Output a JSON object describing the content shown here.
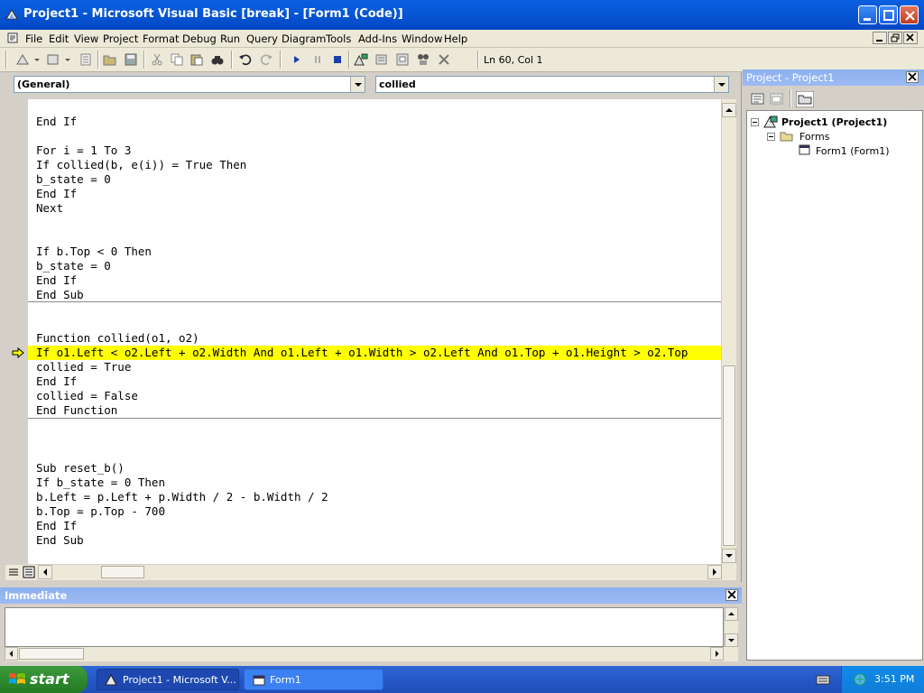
{
  "window": {
    "title": "Project1 - Microsoft Visual Basic [break] - [Form1 (Code)]"
  },
  "menu": {
    "items": [
      "File",
      "Edit",
      "View",
      "Project",
      "Format",
      "Debug",
      "Run",
      "Query",
      "Diagram",
      "Tools",
      "Add-Ins",
      "Window",
      "Help"
    ]
  },
  "toolbar": {
    "position_label": "Ln 60, Col 1"
  },
  "code": {
    "object_combo": "(General)",
    "procedure_combo": "collied",
    "lines": [
      "End If",
      "",
      "For i = 1 To 3",
      "If collied(b, e(i)) = True Then",
      "b_state = 0",
      "End If",
      "Next",
      "",
      "",
      "If b.Top < 0 Then",
      "b_state = 0",
      "End If",
      "End Sub",
      "",
      "",
      "Function collied(o1, o2)",
      "If o1.Left < o2.Left + o2.Width And o1.Left + o1.Width > o2.Left And o1.Top + o1.Height > o2.Top",
      "collied = True",
      "End If",
      "collied = False",
      "End Function",
      "",
      "",
      "",
      "Sub reset_b()",
      "If b_state = 0 Then",
      "b.Left = p.Left + p.Width / 2 - b.Width / 2",
      "b.Top = p.Top - 700",
      "End If",
      "End Sub"
    ],
    "highlighted_line_index": 16
  },
  "project": {
    "title": "Project - Project1",
    "root": "Project1 (Project1)",
    "folder": "Forms",
    "item": "Form1 (Form1)"
  },
  "immediate": {
    "title": "Immediate"
  },
  "taskbar": {
    "start_label": "start",
    "tasks": [
      "Project1 - Microsoft V...",
      "Form1"
    ],
    "clock": "3:51 PM"
  },
  "colors": {
    "highlight": "#ffff00",
    "title_blue": "#0a5fe0",
    "start_green": "#2f8a2f"
  }
}
